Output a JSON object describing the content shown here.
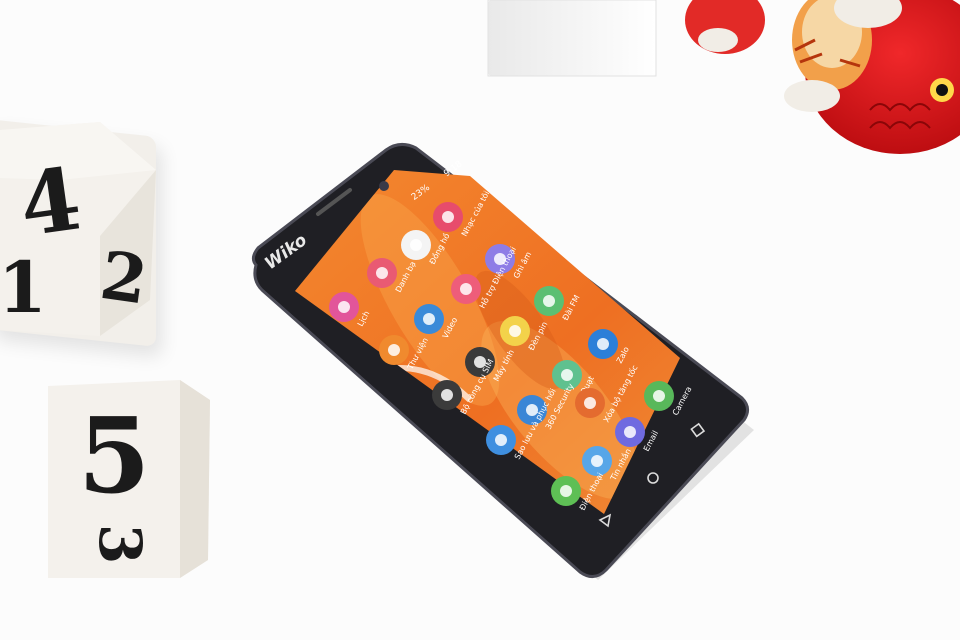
{
  "device": {
    "brand": "Wiko",
    "status_bar": {
      "battery": "23%",
      "time": "9:18"
    }
  },
  "apps": [
    {
      "id": "music",
      "label": "Nhạc của tôi",
      "color": "#e74c6c",
      "icon": "headphones-icon"
    },
    {
      "id": "clock",
      "label": "Đồng hồ",
      "color": "#f4f4f4",
      "icon": "clock-icon"
    },
    {
      "id": "contacts",
      "label": "Danh bạ",
      "color": "#e95a73",
      "icon": "contacts-icon"
    },
    {
      "id": "recorder",
      "label": "Ghi âm",
      "color": "#8e7ce6",
      "icon": "microphone-icon"
    },
    {
      "id": "guide",
      "label": "Hỗ trợ Điện thoại",
      "color": "#ee5d7a",
      "icon": "wiko-icon"
    },
    {
      "id": "calendar",
      "label": "Lịch",
      "color": "#e2559a",
      "icon": "calendar-icon"
    },
    {
      "id": "radio",
      "label": "Đài FM",
      "color": "#5bbf72",
      "icon": "radio-icon"
    },
    {
      "id": "video",
      "label": "Video",
      "color": "#3a8ad8",
      "icon": "video-icon"
    },
    {
      "id": "flashlight",
      "label": "Đèn pin",
      "color": "#f3d24a",
      "icon": "flashlight-icon"
    },
    {
      "id": "zalo",
      "label": "Zalo",
      "color": "#2c7fd8",
      "icon": "zalo-icon"
    },
    {
      "id": "gallery",
      "label": "Thư viện",
      "color": "#f08a2e",
      "icon": "gallery-icon"
    },
    {
      "id": "calculator",
      "label": "Máy tính",
      "color": "#3a3a3a",
      "icon": "calculator-icon"
    },
    {
      "id": "fan",
      "label": "Quạt",
      "color": "#5fc18f",
      "icon": "fan-icon"
    },
    {
      "id": "sim",
      "label": "Bộ công cụ SIM",
      "color": "#3b3b3b",
      "icon": "sim-icon"
    },
    {
      "id": "security",
      "label": "360 Security",
      "color": "#3a86d6",
      "icon": "shield-icon"
    },
    {
      "id": "cleaner",
      "label": "Xóa bộ tăng tốc",
      "color": "#e46b2f",
      "icon": "cleaner-icon"
    },
    {
      "id": "camera",
      "label": "Camera",
      "color": "#58b85a",
      "icon": "camera-icon"
    },
    {
      "id": "backup",
      "label": "Sao lưu và phục hồi",
      "color": "#3f8fe0",
      "icon": "refresh-icon"
    },
    {
      "id": "email",
      "label": "Email",
      "color": "#6f6ae0",
      "icon": "email-icon"
    },
    {
      "id": "messages",
      "label": "Tin nhắn",
      "color": "#57a6e8",
      "icon": "messages-icon"
    },
    {
      "id": "phone",
      "label": "Điện thoại",
      "color": "#5ebf55",
      "icon": "phone-icon"
    }
  ],
  "dice": [
    {
      "faces": [
        "4",
        "2",
        "1"
      ]
    },
    {
      "faces": [
        "5",
        "3"
      ]
    }
  ],
  "colors": {
    "screen_orange": "#f07a2a",
    "phone_body": "#1e1e22"
  }
}
